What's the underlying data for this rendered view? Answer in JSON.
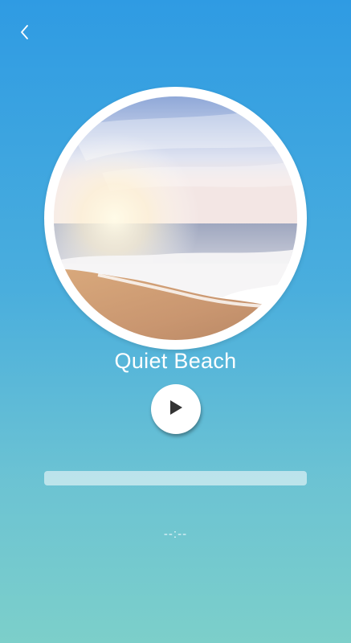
{
  "header": {
    "back_icon": "chevron-left-icon"
  },
  "player": {
    "artwork_description_icon": "beach-artwork",
    "title": "Quiet Beach",
    "play_icon": "play-icon",
    "progress_fraction": 0,
    "time_display": "--:--"
  },
  "colors": {
    "gradient_top": "#2f9be3",
    "gradient_bottom": "#7ccfca",
    "accent": "#ffffff",
    "play_glyph": "#333333"
  }
}
